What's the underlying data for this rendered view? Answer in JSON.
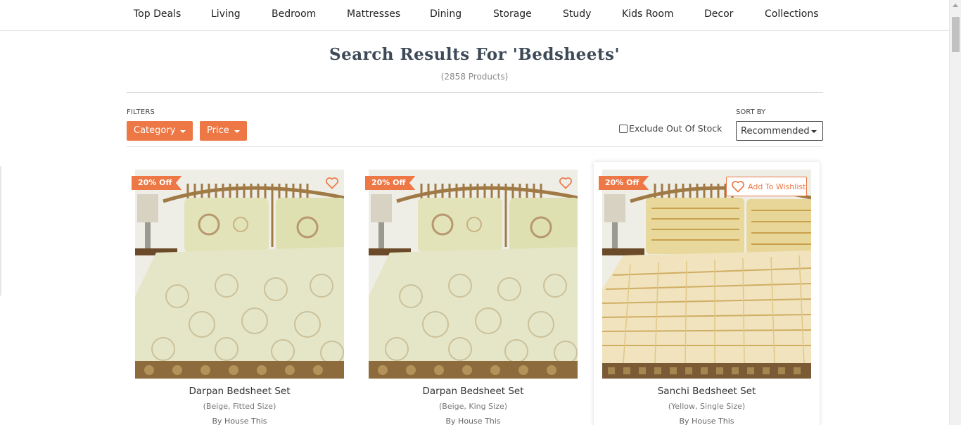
{
  "nav": {
    "items": [
      "Top Deals",
      "Living",
      "Bedroom",
      "Mattresses",
      "Dining",
      "Storage",
      "Study",
      "Kids Room",
      "Decor",
      "Collections"
    ]
  },
  "search": {
    "title": "Search Results For 'Bedsheets'",
    "count": "(2858 Products)"
  },
  "filters": {
    "label": "FILTERS",
    "category": "Category",
    "price": "Price",
    "exclude_out_of_stock": "Exclude Out Of Stock",
    "exclude_checked": false
  },
  "sort": {
    "label": "SORT BY",
    "selected": "Recommended"
  },
  "colors": {
    "accent": "#ed7745",
    "title": "#3e4a57"
  },
  "products": [
    {
      "name": "Darpan Bedsheet Set",
      "variant": "(Beige, Fitted Size)",
      "brand": "By House This",
      "discount": "20% Off",
      "icon": "heart-icon"
    },
    {
      "name": "Darpan Bedsheet Set",
      "variant": "(Beige, King Size)",
      "brand": "By House This",
      "discount": "20% Off",
      "icon": "heart-icon"
    },
    {
      "name": "Sanchi Bedsheet Set",
      "variant": "(Yellow, Single Size)",
      "brand": "By House This",
      "discount": "20% Off",
      "wishlist_label": "Add To Wishlist",
      "icon": "heart-icon"
    }
  ]
}
